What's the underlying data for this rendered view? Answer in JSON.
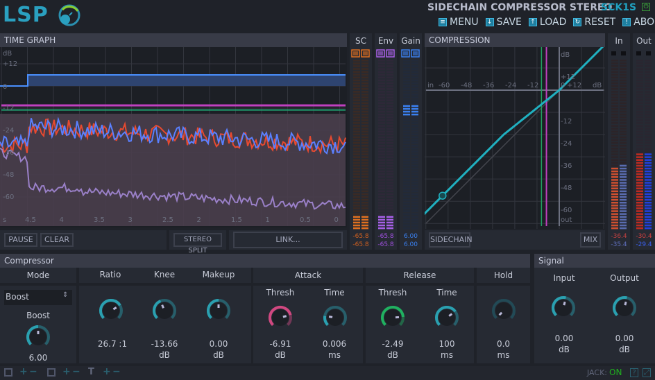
{
  "header": {
    "logo": "LSP",
    "plugin_title": "SIDECHAIN COMPRESSOR STEREO",
    "plugin_code": "SCK1S",
    "power_icon": "power-icon",
    "menu": [
      {
        "label": "MENU",
        "icon": "menu-icon"
      },
      {
        "label": "SAVE",
        "icon": "save-icon"
      },
      {
        "label": "LOAD",
        "icon": "load-icon"
      },
      {
        "label": "RESET",
        "icon": "reset-icon"
      },
      {
        "label": "ABOUT",
        "icon": "about-icon"
      }
    ]
  },
  "time_graph": {
    "title": "TIME GRAPH",
    "y_unit": "dB",
    "y_labels": [
      "+12",
      "0",
      "-12",
      "-24",
      "-36",
      "-48",
      "-60"
    ],
    "x_unit": "s",
    "x_labels": [
      "4.5",
      "4",
      "3.5",
      "3",
      "2.5",
      "2",
      "1.5",
      "1",
      "0.5",
      "0"
    ],
    "buttons": {
      "pause": "PAUSE",
      "clear": "CLEAR",
      "stereo_split": "STEREO SPLIT",
      "link": "LINK..."
    },
    "colors": {
      "gain": "#4a90ff",
      "threshold_attack": "#c040c0",
      "threshold_release": "#20a070",
      "left": "#e84a30",
      "right": "#5a80ff",
      "envelope": "#9a80c8"
    }
  },
  "meters": {
    "sc": {
      "label": "SC",
      "values": [
        "-65.8",
        "-65.8"
      ],
      "color": "#e07020"
    },
    "env": {
      "label": "Env",
      "values": [
        "-65.8",
        "-65.8"
      ],
      "color": "#b040e0"
    },
    "gain": {
      "label": "Gain",
      "values": [
        "6.00",
        "6.00"
      ],
      "color": "#3a80f0"
    },
    "in": {
      "label": "In",
      "values": [
        "-36.4",
        "-35.4"
      ],
      "levels_db": [
        -36.4,
        -35.4
      ]
    },
    "out": {
      "label": "Out",
      "values": [
        "-30.4",
        "-29.4"
      ],
      "levels_db": [
        -30.4,
        -29.4
      ]
    }
  },
  "compression": {
    "title": "COMPRESSION",
    "x_labels": [
      "in",
      "-60",
      "-48",
      "-36",
      "-24",
      "-12",
      "0",
      "+12",
      "dB"
    ],
    "y_labels": [
      "dB",
      "+12",
      "-12",
      "-24",
      "-36",
      "-48",
      "-60",
      "out"
    ],
    "buttons": {
      "sidechain": "SIDECHAIN",
      "mix": "MIX"
    },
    "curve_color": "#20b0c0"
  },
  "compressor": {
    "title": "Compressor",
    "mode": {
      "label": "Mode",
      "selected": "Boost"
    },
    "boost": {
      "label": "Boost",
      "value": "6.00"
    },
    "ratio": {
      "label": "Ratio",
      "value": "26.7 :1"
    },
    "knee": {
      "label": "Knee",
      "value": "-13.66",
      "unit": "dB"
    },
    "makeup": {
      "label": "Makeup",
      "value": "0.00",
      "unit": "dB"
    },
    "attack": {
      "label": "Attack",
      "thresh_label": "Thresh",
      "thresh_value": "-6.91",
      "thresh_unit": "dB",
      "time_label": "Time",
      "time_value": "0.006",
      "time_unit": "ms"
    },
    "release": {
      "label": "Release",
      "thresh_label": "Thresh",
      "thresh_value": "-2.49",
      "thresh_unit": "dB",
      "time_label": "Time",
      "time_value": "100",
      "time_unit": "ms"
    },
    "hold": {
      "label": "Hold",
      "value": "0.0",
      "unit": "ms"
    }
  },
  "signal": {
    "title": "Signal",
    "input": {
      "label": "Input",
      "value": "0.00",
      "unit": "dB"
    },
    "output": {
      "label": "Output",
      "value": "0.00",
      "unit": "dB"
    }
  },
  "statusbar": {
    "jack_label": "JACK:",
    "jack_status": "ON",
    "plus": "+",
    "minus": "−"
  }
}
